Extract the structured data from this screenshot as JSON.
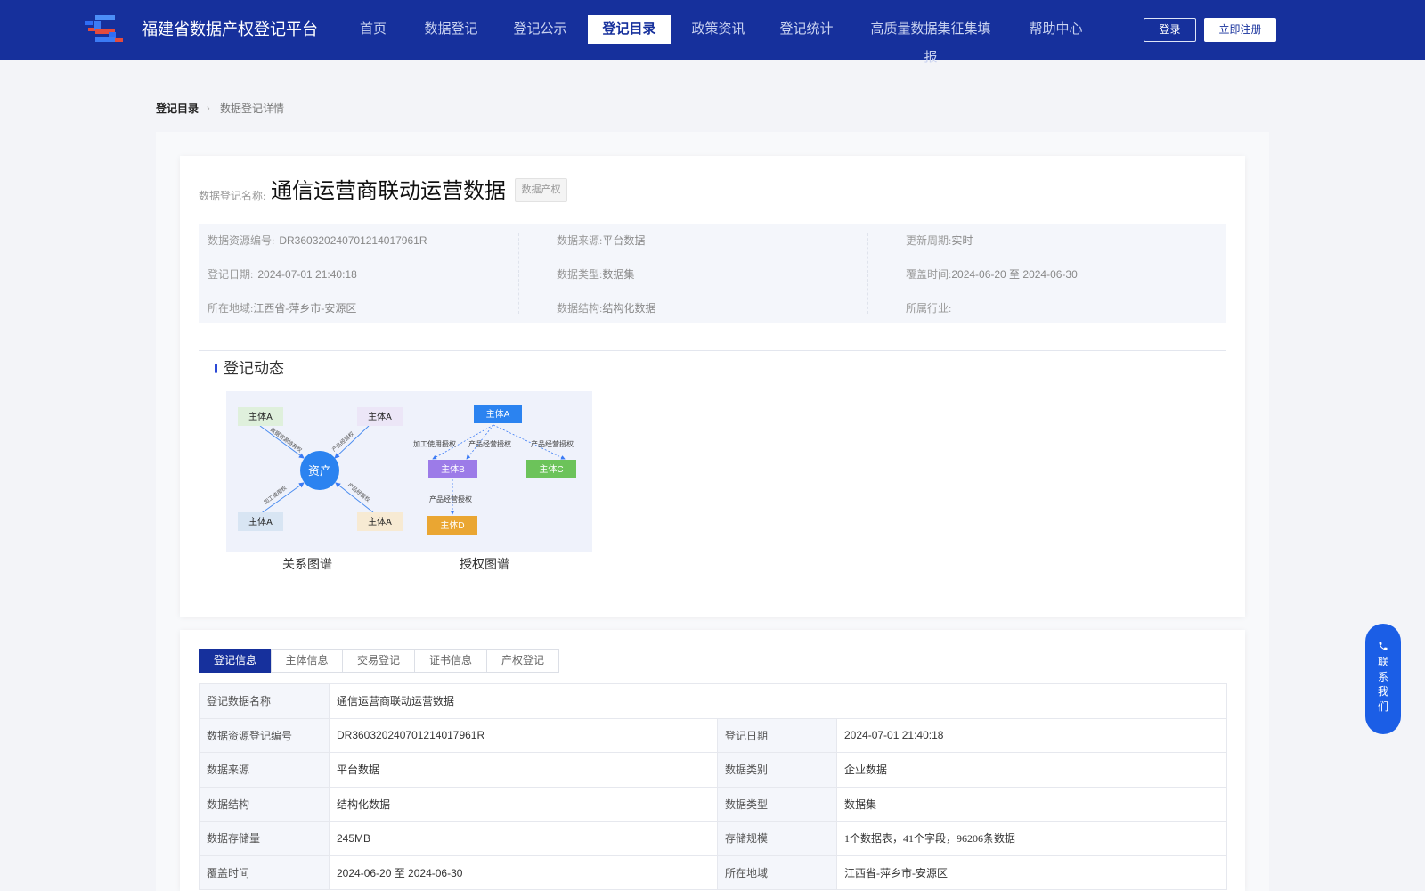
{
  "header": {
    "site_title": "福建省数据产权登记平台",
    "nav": [
      {
        "label": "首页"
      },
      {
        "label": "数据登记"
      },
      {
        "label": "登记公示"
      },
      {
        "label": "登记目录",
        "active": true
      },
      {
        "label": "政策资讯"
      },
      {
        "label": "登记统计"
      },
      {
        "label": "高质量数据集征集填报"
      },
      {
        "label": "帮助中心"
      }
    ],
    "login_label": "登录",
    "register_label": "立即注册",
    "brand_color": "#16309c"
  },
  "breadcrumb": {
    "root": "登记目录",
    "current": "数据登记详情"
  },
  "detail": {
    "name_label": "数据登记名称:",
    "name": "通信运营商联动运营数据",
    "tag": "数据产权",
    "meta": {
      "resource_id_label": "数据资源编号:",
      "resource_id": "DR360320240701214017961R",
      "source_label": "数据来源:",
      "source": "平台数据",
      "cycle_label": "更新周期:",
      "cycle": "实时",
      "reg_date_label": "登记日期:",
      "reg_date": "2024-07-01 21:40:18",
      "data_type_label": "数据类型:",
      "data_type": "数据集",
      "coverage_label": "覆盖时间:",
      "coverage": "2024-06-20 至 2024-06-30",
      "region_label": "所在地域:",
      "region": "江西省-萍乡市-安源区",
      "structure_label": "数据结构:",
      "structure": "结构化数据",
      "industry_label": "所属行业:",
      "industry": ""
    }
  },
  "dynamics": {
    "title": "登记动态",
    "relation_caption": "关系图谱",
    "auth_caption": "授权图谱",
    "relation_graph": {
      "center": "资产",
      "nodes": [
        "主体A",
        "主体A",
        "主体A",
        "主体A"
      ],
      "edges": [
        "数据资源持有权",
        "产品经营权",
        "加工使用权",
        "产品经营权"
      ]
    },
    "auth_graph": {
      "nodes": [
        "主体A",
        "主体B",
        "主体C",
        "主体D"
      ],
      "edges": [
        "加工使用授权",
        "产品经营授权",
        "产品经营授权",
        "产品经营授权"
      ]
    }
  },
  "tabs": [
    {
      "label": "登记信息",
      "active": true
    },
    {
      "label": "主体信息"
    },
    {
      "label": "交易登记"
    },
    {
      "label": "证书信息"
    },
    {
      "label": "产权登记"
    }
  ],
  "info_table": {
    "name_key": "登记数据名称",
    "name_value": "通信运营商联动运营数据",
    "rows": [
      {
        "k1": "数据资源登记编号",
        "v1": "DR360320240701214017961R",
        "k2": "登记日期",
        "v2": "2024-07-01 21:40:18"
      },
      {
        "k1": "数据来源",
        "v1": "平台数据",
        "k2": "数据类别",
        "v2": "企业数据"
      },
      {
        "k1": "数据结构",
        "v1": "结构化数据",
        "k2": "数据类型",
        "v2": "数据集"
      },
      {
        "k1": "数据存储量",
        "v1": "245MB",
        "k2": "存储规模",
        "v2": "1个数据表，41个字段，96206条数据"
      },
      {
        "k1": "覆盖时间",
        "v1": "2024-06-20 至 2024-06-30",
        "k2": "所在地域",
        "v2": "江西省-萍乡市-安源区"
      }
    ]
  },
  "contact": {
    "label": "联系我们",
    "chars": [
      "联",
      "系",
      "我",
      "们"
    ]
  }
}
